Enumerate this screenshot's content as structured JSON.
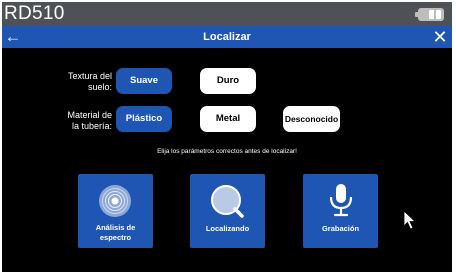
{
  "device": {
    "name": "RD510"
  },
  "titlebar": {
    "title": "Localizar",
    "back_icon": "arrow-left-icon",
    "close_icon": "close-icon"
  },
  "soil": {
    "label_line1": "Textura del",
    "label_line2": "suelo:",
    "options": [
      {
        "label": "Suave",
        "selected": true
      },
      {
        "label": "Duro",
        "selected": false
      }
    ]
  },
  "pipe": {
    "label_line1": "Material de",
    "label_line2": "la tubería:",
    "options": [
      {
        "label": "Plástico",
        "selected": true
      },
      {
        "label": "Metal",
        "selected": false
      },
      {
        "label": "Desconocido",
        "selected": false
      }
    ]
  },
  "hint": "Elija los parámetros correctos antes de localizar!",
  "tiles": [
    {
      "line1": "Análisis de",
      "line2": "espectro",
      "icon": "spectrum-icon"
    },
    {
      "label": "Localizando",
      "icon": "search-magnifier-icon"
    },
    {
      "label": "Grabación",
      "icon": "microphone-icon"
    }
  ],
  "colors": {
    "accent": "#1f56b3",
    "status_bar": "#4e5156",
    "background": "#000000"
  }
}
